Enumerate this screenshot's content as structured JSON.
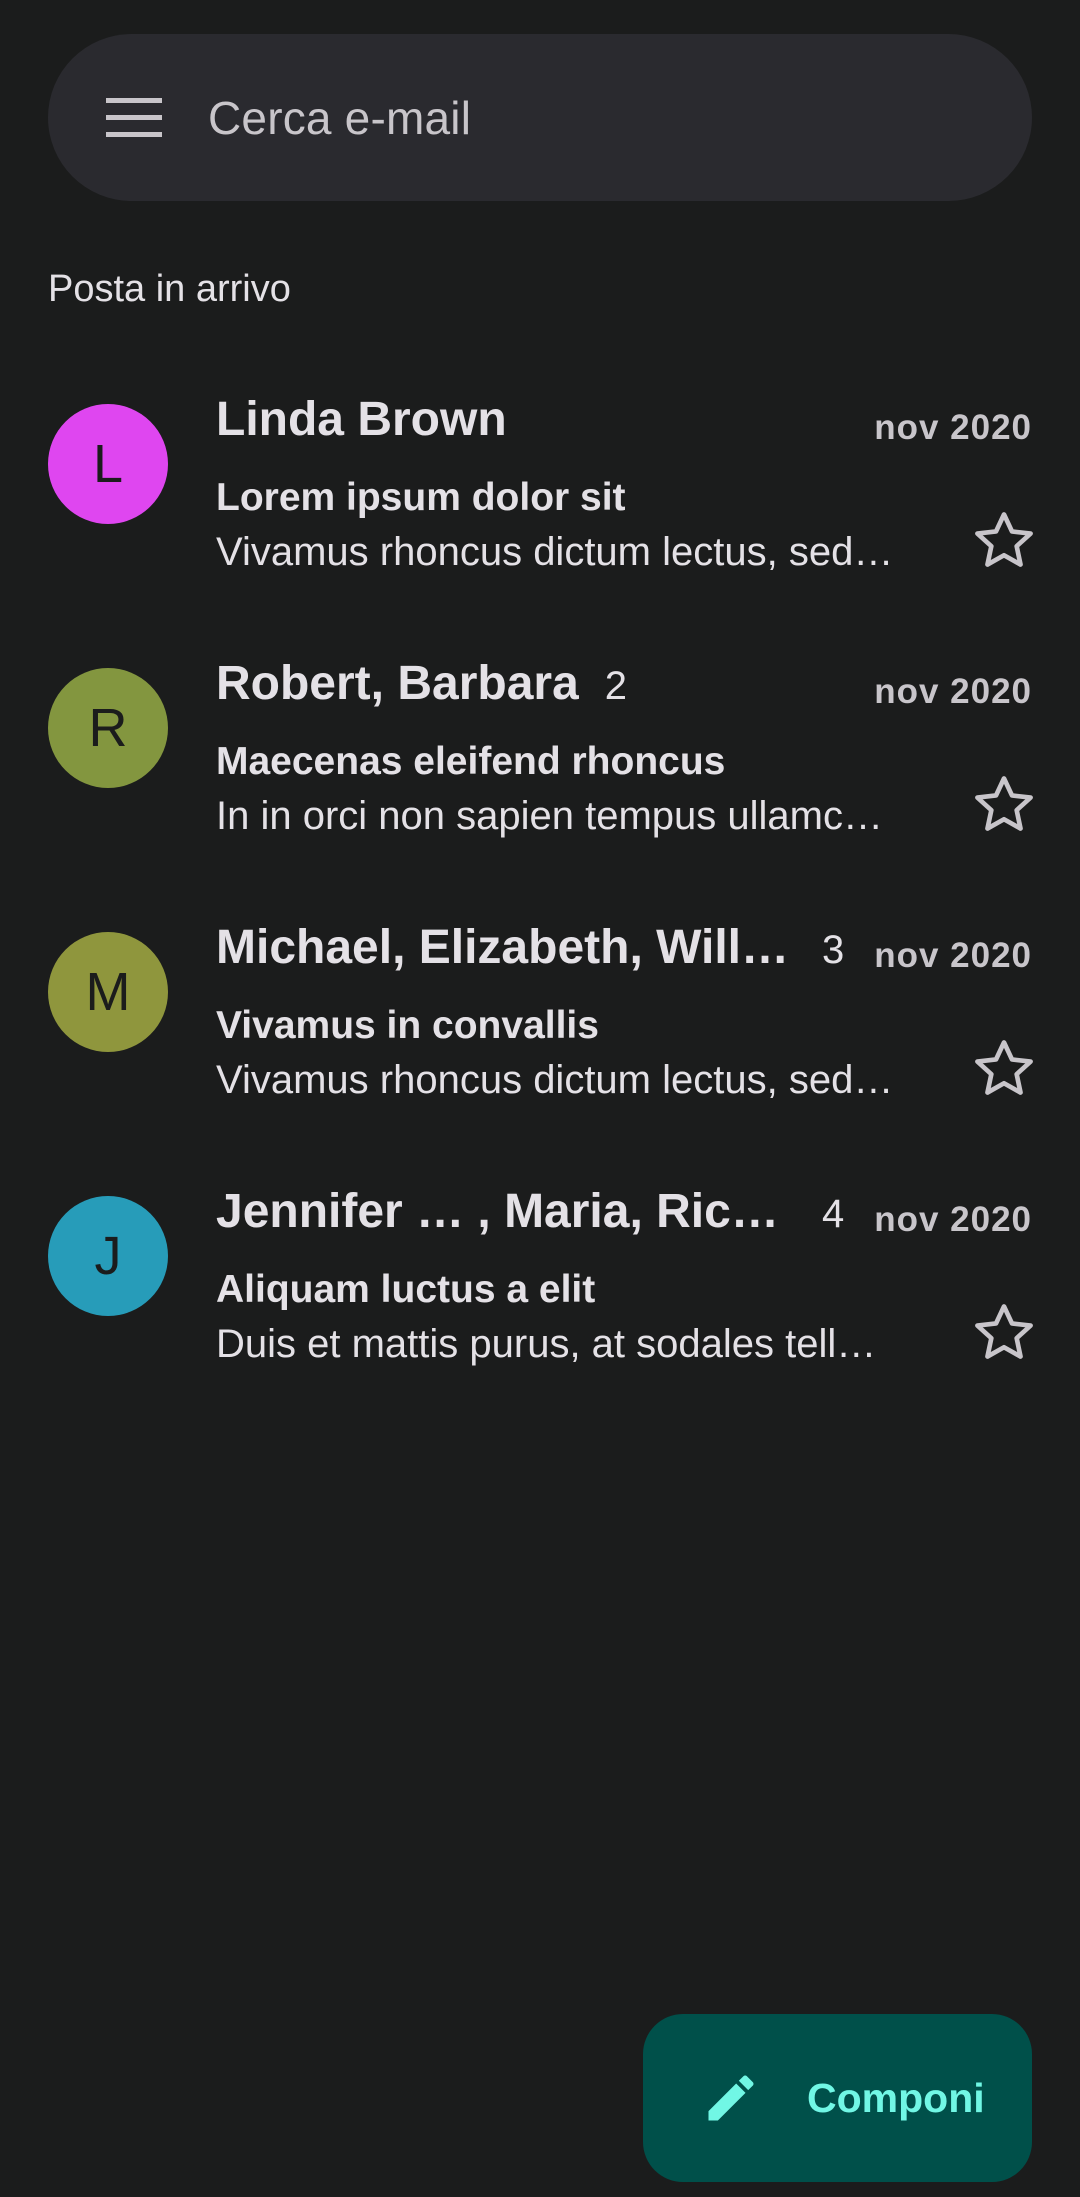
{
  "search": {
    "placeholder": "Cerca e-mail",
    "menu_icon": "menu-icon"
  },
  "section": {
    "title": "Posta in arrivo"
  },
  "emails": [
    {
      "avatar_letter": "L",
      "avatar_color": "#df46f0",
      "senders": "Linda Brown",
      "count": "",
      "date": "nov 2020",
      "subject": "Lorem ipsum dolor sit",
      "snippet": "Vivamus rhoncus dictum lectus, sed…",
      "starred": false
    },
    {
      "avatar_letter": "R",
      "avatar_color": "#83963f",
      "senders": "Robert, Barbara",
      "count": "2",
      "date": "nov 2020",
      "subject": "Maecenas eleifend rhoncus",
      "snippet": "In in orci non sapien tempus ullamc…",
      "starred": false
    },
    {
      "avatar_letter": "M",
      "avatar_color": "#8f963d",
      "senders": "Michael, Elizabeth, Willi…",
      "count": "3",
      "date": "nov 2020",
      "subject": "Vivamus in convallis",
      "snippet": "Vivamus rhoncus dictum lectus, sed…",
      "starred": false
    },
    {
      "avatar_letter": "J",
      "avatar_color": "#279cb9",
      "senders": "Jennifer … , Maria, Rich…",
      "count": "4",
      "date": "nov 2020",
      "subject": "Aliquam luctus a elit",
      "snippet": "Duis et mattis purus, at sodales tell…",
      "starred": false
    }
  ],
  "fab": {
    "label": "Componi",
    "icon": "pencil-icon"
  },
  "colors": {
    "background": "#1b1c1c",
    "search_bar": "#2a2a2f",
    "fab_background": "#00504a",
    "fab_foreground": "#71f7e5",
    "text_primary": "#e4e1e6",
    "text_secondary": "#c8c5ca"
  }
}
